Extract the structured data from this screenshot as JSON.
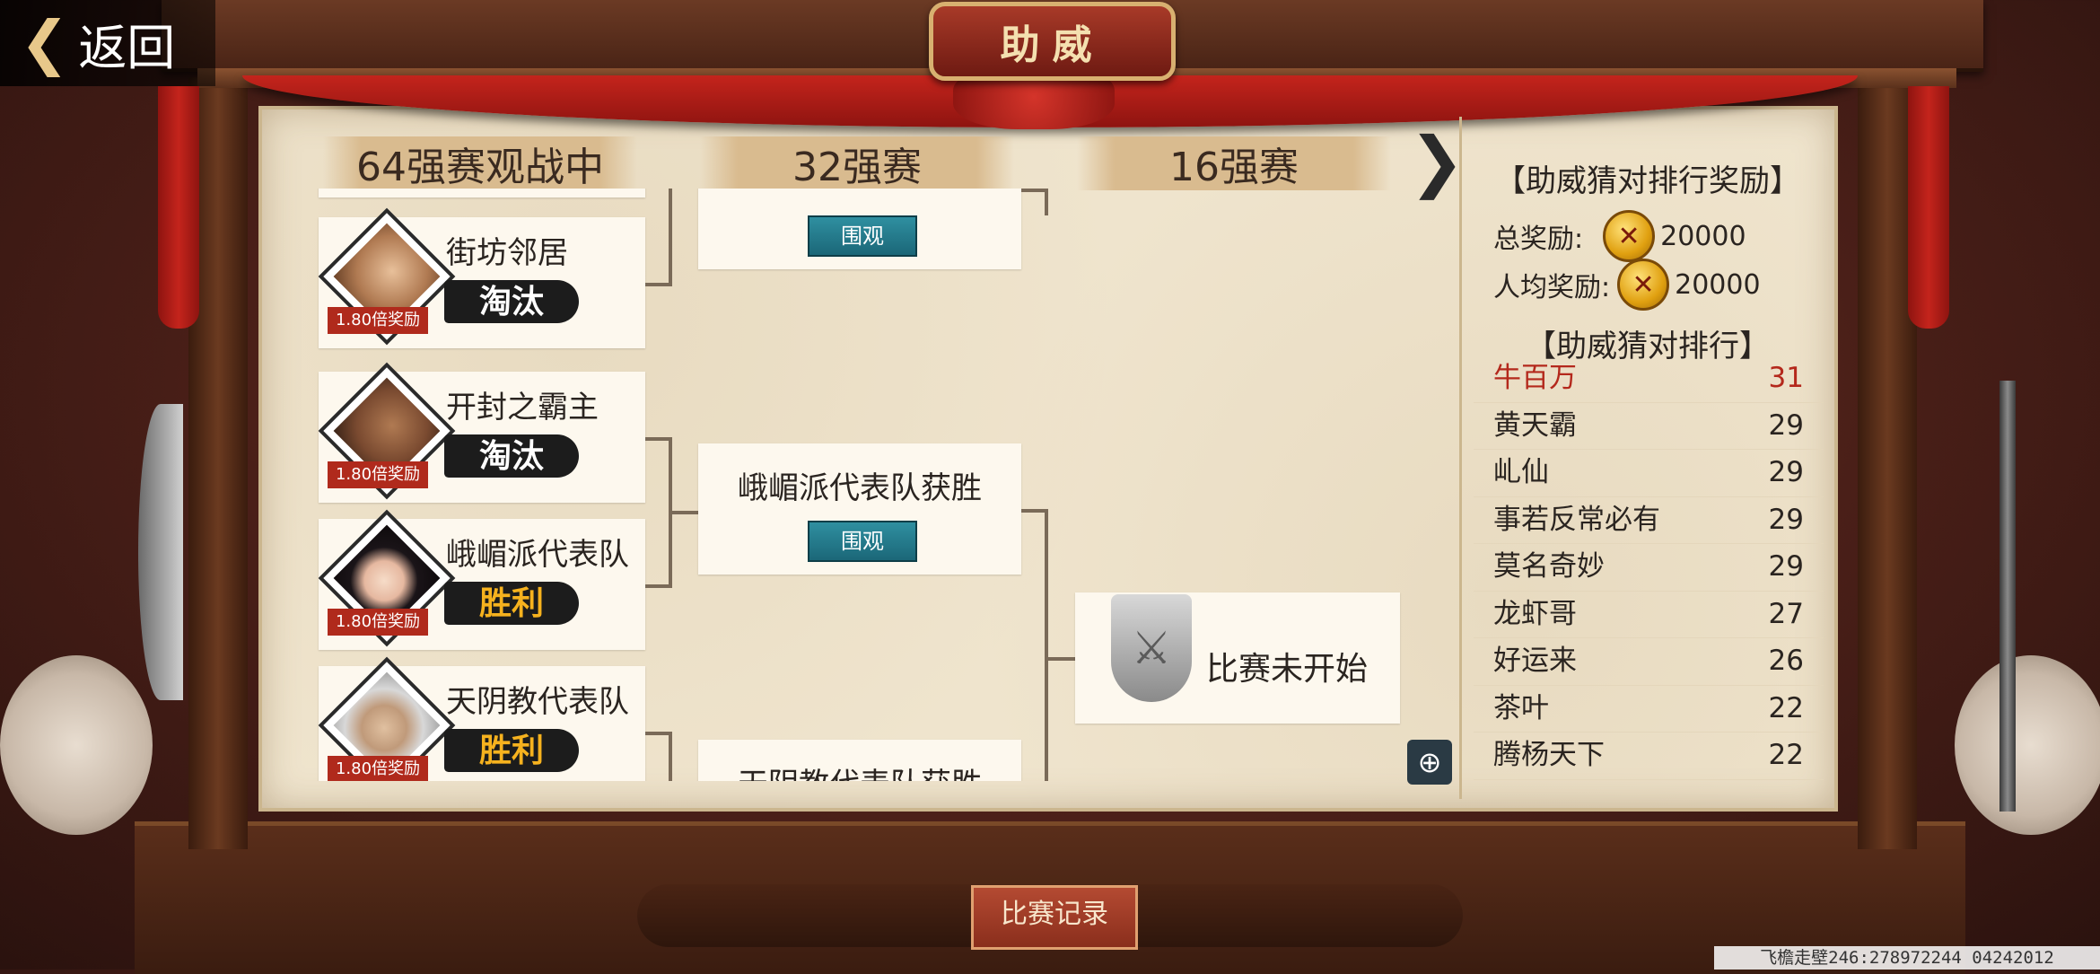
{
  "header": {
    "back_label": "返回",
    "title": "助威"
  },
  "rounds": [
    "64强赛观战中",
    "32强赛",
    "16强赛"
  ],
  "round64": [
    {
      "name": "街坊邻居",
      "reward": "1.80倍奖励",
      "result": "淘汰",
      "status": "lose"
    },
    {
      "name": "开封之霸主",
      "reward": "1.80倍奖励",
      "result": "淘汰",
      "status": "lose"
    },
    {
      "name": "峨嵋派代表队",
      "reward": "1.80倍奖励",
      "result": "胜利",
      "status": "win"
    },
    {
      "name": "天阴教代表队",
      "reward": "1.80倍奖励",
      "result": "胜利",
      "status": "win"
    }
  ],
  "round32": [
    {
      "text": "",
      "watch": "围观"
    },
    {
      "text": "峨嵋派代表队获胜",
      "watch": "围观"
    },
    {
      "text": "天阴教代表队获胜",
      "watch": ""
    }
  ],
  "round16": {
    "text": "比赛未开始"
  },
  "panel": {
    "reward_title": "【助威猜对排行奖励】",
    "total_label": "总奖励:",
    "total_value": "20000",
    "per_label": "人均奖励:",
    "per_value": "20000",
    "rank_title": "【助威猜对排行】",
    "ranks": [
      {
        "name": "牛百万",
        "score": "31"
      },
      {
        "name": "黄天霸",
        "score": "29"
      },
      {
        "name": "乢仙",
        "score": "29"
      },
      {
        "name": "事若反常必有",
        "score": "29"
      },
      {
        "name": "莫名奇妙",
        "score": "29"
      },
      {
        "name": "龙虾哥",
        "score": "27"
      },
      {
        "name": "好运来",
        "score": "26"
      },
      {
        "name": "茶叶",
        "score": "22"
      },
      {
        "name": "腾杨天下",
        "score": "22"
      }
    ]
  },
  "footer": {
    "record_label": "比赛记录",
    "watermark": "飞檐走壁246:278972244 04242012"
  },
  "colors": {
    "paper": "#efe4cd",
    "watch_button": "#1b6778",
    "win": "#f6b21e",
    "rank_first": "#b4281c",
    "reward_tag": "#b02a1c"
  }
}
